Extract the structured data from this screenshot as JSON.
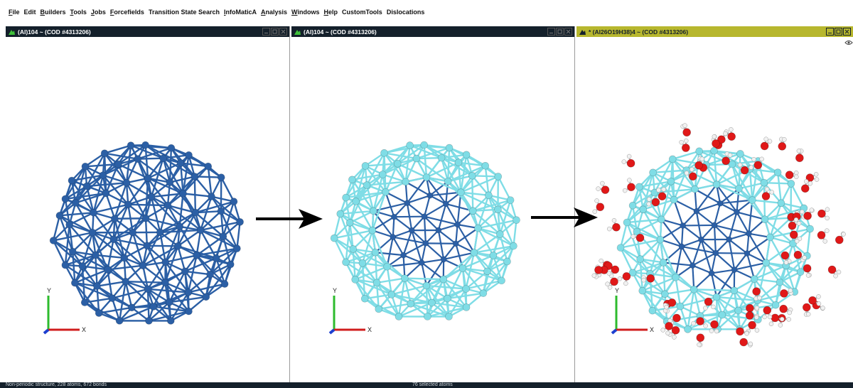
{
  "menu": [
    {
      "label": "File",
      "u": "F"
    },
    {
      "label": "Edit",
      "u": ""
    },
    {
      "label": "Builders",
      "u": "B"
    },
    {
      "label": "Tools",
      "u": "T"
    },
    {
      "label": "Jobs",
      "u": "J"
    },
    {
      "label": "Forcefields",
      "u": "F"
    },
    {
      "label": "Transition State Search",
      "u": ""
    },
    {
      "label": "InfoMaticA",
      "u": "I"
    },
    {
      "label": "Analysis",
      "u": "A"
    },
    {
      "label": "Windows",
      "u": "W"
    },
    {
      "label": "Help",
      "u": "H"
    },
    {
      "label": "CustomTools",
      "u": ""
    },
    {
      "label": "Dislocations",
      "u": ""
    }
  ],
  "windows": [
    {
      "title": "(Al)104 ~ (COD #4313206)",
      "active": false
    },
    {
      "title": "(Al)104 ~ (COD #4313206)",
      "active": false
    },
    {
      "title": "* (Al26O19H38)4 ~ (COD #4313206)",
      "active": true
    }
  ],
  "axes": {
    "x": "X",
    "y": "Y"
  },
  "status": {
    "left": "Non-periodic structure, 228 atoms, 672 bonds",
    "middle": "76 selected atoms"
  },
  "colors": {
    "al_dark": "#2b5fa5",
    "al_light": "#7fdde6",
    "oxygen": "#e01818",
    "hydrogen": "#f1f1f1",
    "titlebar": "#14202b",
    "titlebar_active": "#b7b72e"
  }
}
